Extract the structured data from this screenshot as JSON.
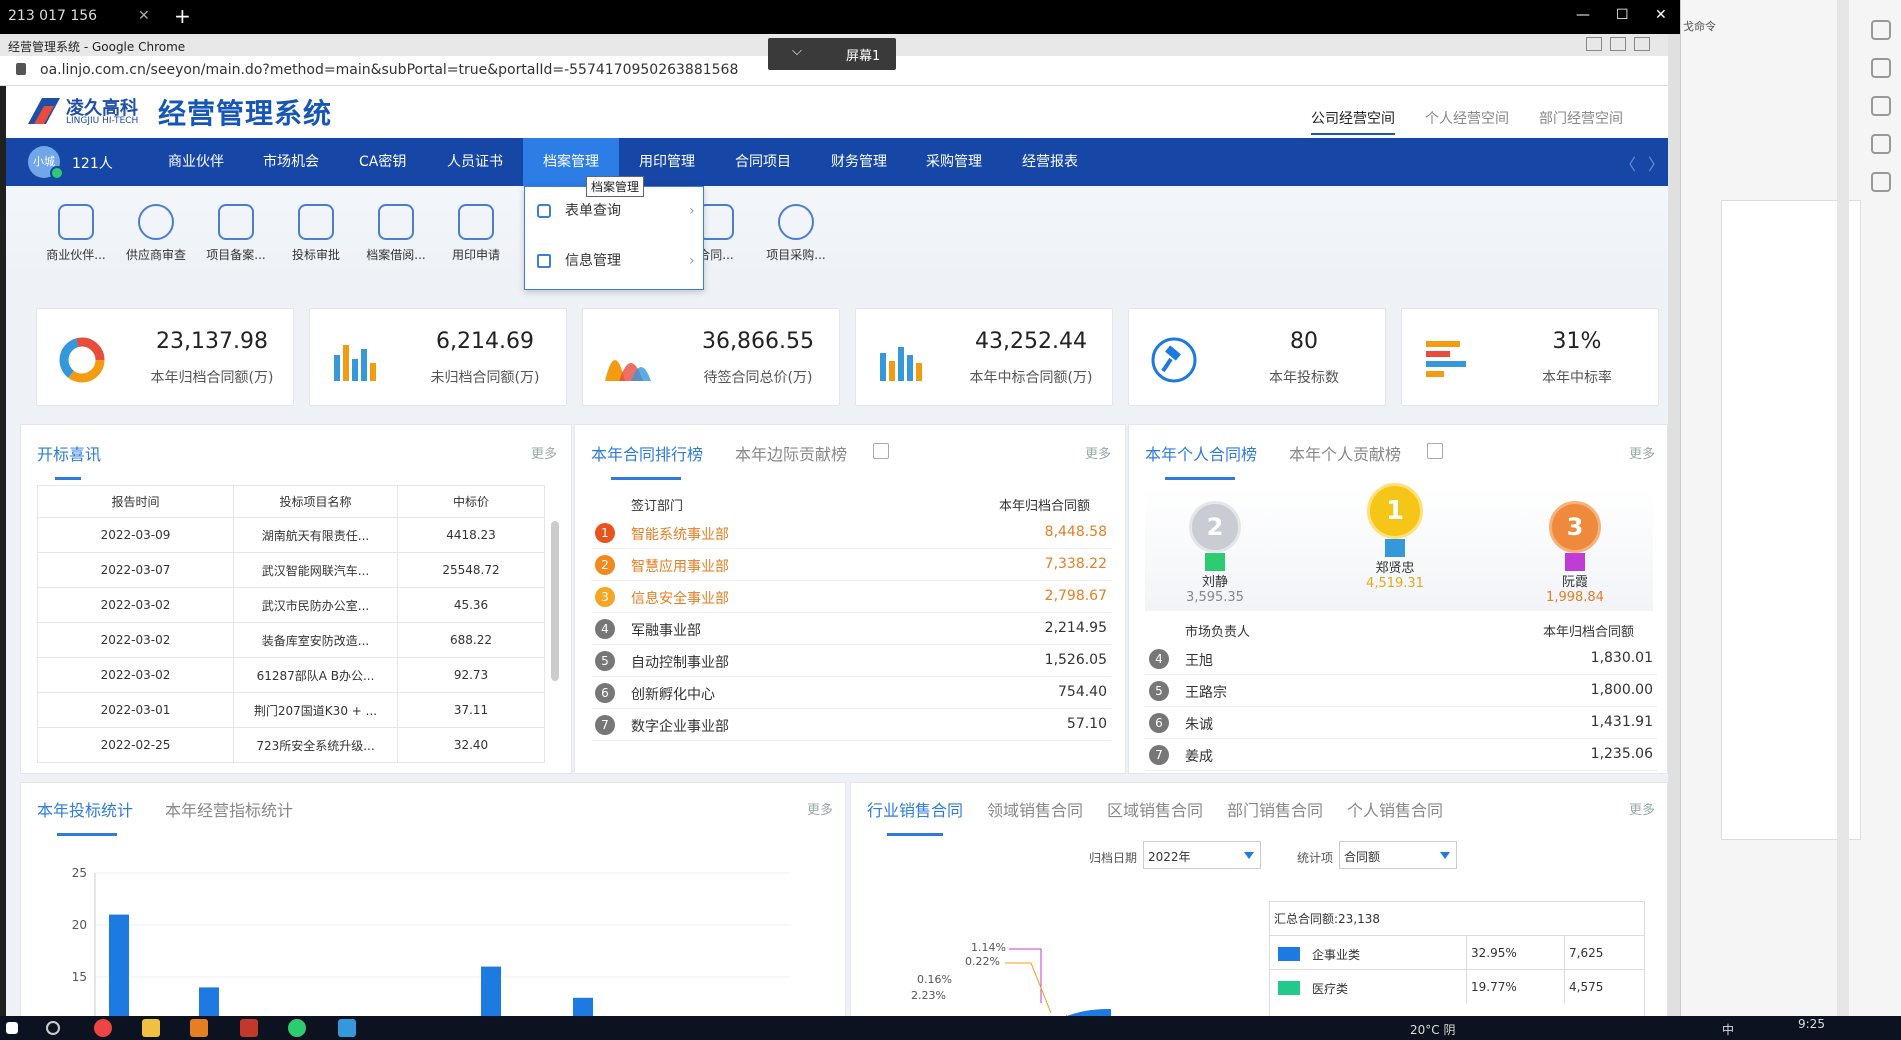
{
  "remote_bar": {
    "tab_title": "213 017 156",
    "close": "✕",
    "plus": "+",
    "min": "—",
    "max": "☐",
    "close_win": "✕"
  },
  "screen_pill": {
    "label": "屏幕1",
    "chevron": "⌵"
  },
  "chrome": {
    "title": "经营管理系统 - Google Chrome",
    "url": "oa.linjo.com.cn/seeyon/main.do?method=main&subPortal=true&portalId=-5574170950263881568"
  },
  "right_panel": {
    "text": "戈命令"
  },
  "header": {
    "logo_cn": "凌久高科",
    "logo_en": "LINGJIU HI-TECH",
    "system_name": "经营管理系统",
    "spaces": [
      "公司经营空间",
      "个人经营空间",
      "部门经营空间"
    ]
  },
  "nav": {
    "avatar": "小城",
    "user_count": "121人",
    "items": [
      "商业伙伴",
      "市场机会",
      "CA密钥",
      "人员证书",
      "档案管理",
      "用印管理",
      "合同项目",
      "财务管理",
      "采购管理",
      "经营报表"
    ],
    "active_index": 4,
    "prev": "〈",
    "next": "〉"
  },
  "tooltip": "档案管理",
  "dropdown": {
    "items": [
      "表单查询",
      "信息管理"
    ]
  },
  "quick_links": [
    "商业伙伴...",
    "供应商审查",
    "项目备案...",
    "投标审批",
    "档案借阅...",
    "用印申请",
    "",
    "",
    "合同...",
    "项目采购..."
  ],
  "stats": [
    {
      "value": "23,137.98",
      "label": "本年归档合同额(万)"
    },
    {
      "value": "6,214.69",
      "label": "未归档合同额(万)"
    },
    {
      "value": "36,866.55",
      "label": "待签合同总价(万)"
    },
    {
      "value": "43,252.44",
      "label": "本年中标合同额(万)"
    },
    {
      "value": "80",
      "label": "本年投标数"
    },
    {
      "value": "31%",
      "label": "本年中标率"
    }
  ],
  "bid_panel": {
    "tab": "开标喜讯",
    "more": "更多",
    "headers": [
      "报告时间",
      "投标项目名称",
      "中标价"
    ],
    "rows": [
      [
        "2022-03-09",
        "湖南航天有限责任...",
        "4418.23"
      ],
      [
        "2022-03-07",
        "武汉智能网联汽车...",
        "25548.72"
      ],
      [
        "2022-03-02",
        "武汉市民防办公室...",
        "45.36"
      ],
      [
        "2022-03-02",
        "装备库室安防改造...",
        "688.22"
      ],
      [
        "2022-03-02",
        "61287部队A B办公...",
        "92.73"
      ],
      [
        "2022-03-01",
        "荆门207国道K30 + ...",
        "37.11"
      ],
      [
        "2022-02-25",
        "723所安全系统升级...",
        "32.40"
      ]
    ]
  },
  "rank_panel": {
    "tabs": [
      "本年合同排行榜",
      "本年边际贡献榜"
    ],
    "more": "更多",
    "col_left": "签订部门",
    "col_right": "本年归档合同额",
    "rows": [
      {
        "no": "1",
        "name": "智能系统事业部",
        "value": "8,448.58"
      },
      {
        "no": "2",
        "name": "智慧应用事业部",
        "value": "7,338.22"
      },
      {
        "no": "3",
        "name": "信息安全事业部",
        "value": "2,798.67"
      },
      {
        "no": "4",
        "name": "军融事业部",
        "value": "2,214.95"
      },
      {
        "no": "5",
        "name": "自动控制事业部",
        "value": "1,526.05"
      },
      {
        "no": "6",
        "name": "创新孵化中心",
        "value": "754.40"
      },
      {
        "no": "7",
        "name": "数字企业事业部",
        "value": "57.10"
      }
    ]
  },
  "personal_panel": {
    "tabs": [
      "本年个人合同榜",
      "本年个人贡献榜"
    ],
    "more": "更多",
    "podium": [
      {
        "rank": "2",
        "name": "刘静",
        "value": "3,595.35"
      },
      {
        "rank": "1",
        "name": "郑贤忠",
        "value": "4,519.31"
      },
      {
        "rank": "3",
        "name": "阮霞",
        "value": "1,998.84"
      }
    ],
    "col_left": "市场负责人",
    "col_right": "本年归档合同额",
    "rows": [
      {
        "no": "4",
        "name": "王旭",
        "value": "1,830.01"
      },
      {
        "no": "5",
        "name": "王路宗",
        "value": "1,800.00"
      },
      {
        "no": "6",
        "name": "朱诚",
        "value": "1,431.91"
      },
      {
        "no": "7",
        "name": "姜成",
        "value": "1,235.06"
      }
    ]
  },
  "bid_stats_panel": {
    "tabs": [
      "本年投标统计",
      "本年经营指标统计"
    ],
    "more": "更多",
    "chart_data": {
      "type": "bar",
      "ylim": [
        10,
        25
      ],
      "yticks": [
        "25",
        "20",
        "15"
      ],
      "values": [
        21,
        14,
        16,
        13
      ]
    }
  },
  "industry_panel": {
    "tabs": [
      "行业销售合同",
      "领域销售合同",
      "区域销售合同",
      "部门销售合同",
      "个人销售合同"
    ],
    "more": "更多",
    "date_label": "归档日期",
    "date_value": "2022年",
    "stat_label": "统计项",
    "stat_value": "合同额",
    "summary": "汇总合同额:23,138",
    "legend": [
      {
        "name": "企事业类",
        "pct": "32.95%",
        "value": "7,625",
        "color": "#1c7ae0"
      },
      {
        "name": "医疗类",
        "pct": "19.77%",
        "value": "4,575",
        "color": "#22c98b"
      }
    ],
    "pie_labels": [
      "1.14%",
      "0.22%",
      "0.16%",
      "2.23%"
    ]
  },
  "taskbar": {
    "weather": "20°C 阴",
    "time": "9:25",
    "ime": "中"
  }
}
